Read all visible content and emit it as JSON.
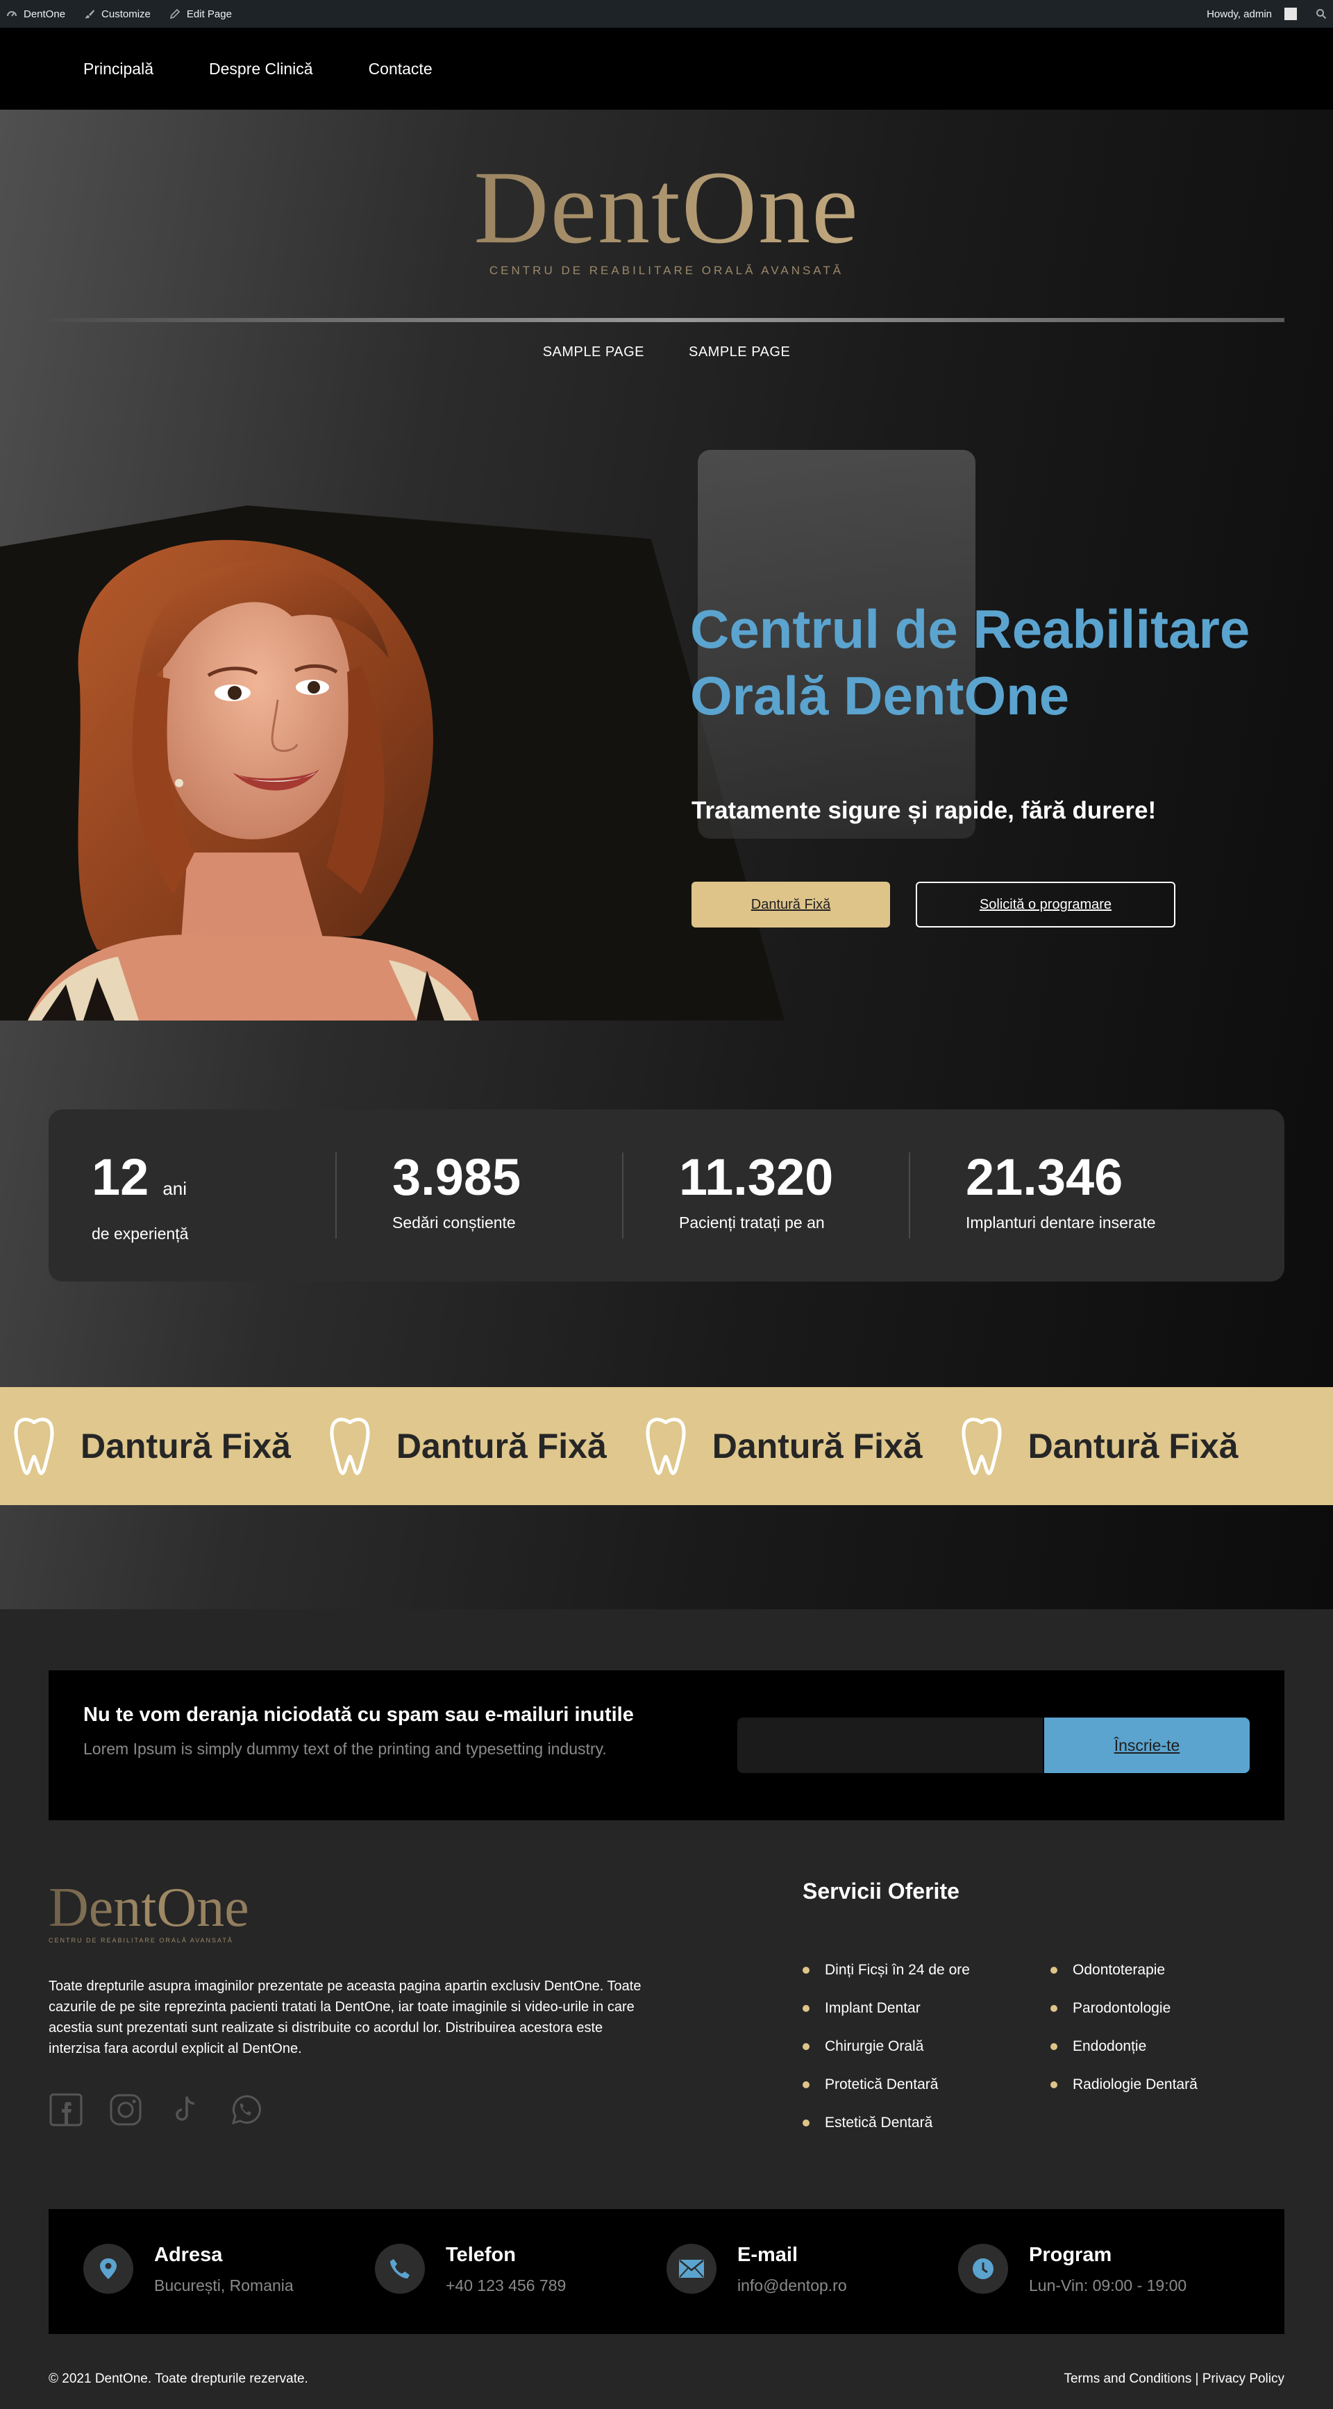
{
  "adminbar": {
    "site_name": "DentOne",
    "customize": "Customize",
    "edit_page": "Edit Page",
    "howdy": "Howdy, admin"
  },
  "topnav": {
    "items": [
      "Principală",
      "Despre Clinică",
      "Contacte"
    ]
  },
  "hero": {
    "logo": "DentOne",
    "logo_tagline": "CENTRU DE REABILITARE ORALĂ AVANSATĂ",
    "subnav": [
      "SAMPLE PAGE",
      "SAMPLE PAGE"
    ],
    "title": "Centrul de Reabilitare Orală DentOne",
    "subtitle": "Tratamente sigure și rapide, fără durere!",
    "btn_primary": "Dantură Fixă",
    "btn_secondary": "Solicită o programare",
    "title_color": "#5ba4cf",
    "accent_color": "#dfc48a"
  },
  "stats": [
    {
      "value": "12",
      "unit": "ani",
      "label": "de experiență"
    },
    {
      "value": "3.985",
      "unit": "",
      "label": "Sedări conștiente"
    },
    {
      "value": "11.320",
      "unit": "",
      "label": "Pacienți tratați pe an"
    },
    {
      "value": "21.346",
      "unit": "",
      "label": "Implanturi dentare inserate"
    }
  ],
  "marquee": {
    "text": "Dantură Fixă",
    "icon": "tooth-icon"
  },
  "newsletter": {
    "title": "Nu te vom deranja niciodată cu spam sau e-mailuri inutile",
    "text": "Lorem Ipsum is simply dummy text of the printing and typesetting industry.",
    "input_placeholder": "",
    "button": "Înscrie-te"
  },
  "footer": {
    "logo": "DentOne",
    "logo_tagline": "CENTRU DE REABILITARE ORALĂ AVANSATĂ",
    "text": "Toate drepturile asupra imaginilor prezentate pe aceasta pagina apartin exclusiv DentOne. Toate cazurile de pe site reprezinta pacienti tratati la DentOne, iar toate imaginile si video-urile in care acestia sunt prezentati sunt realizate si distribuite co acordul lor. Distribuirea acestora este interzisa fara acordul explicit al DentOne.",
    "socials": [
      "facebook-icon",
      "instagram-icon",
      "tiktok-icon",
      "whatsapp-icon"
    ],
    "services_title": "Servicii Oferite",
    "services_col1": [
      "Dinți Ficși în 24 de ore",
      "Implant Dentar",
      "Chirurgie Orală",
      "Protetică Dentară",
      "Estetică Dentară"
    ],
    "services_col2": [
      "Odontoterapie",
      "Parodontologie",
      "Endodonție",
      "Radiologie Dentară"
    ]
  },
  "contacts": [
    {
      "icon": "map-pin-icon",
      "title": "Adresa",
      "value": "București, Romania"
    },
    {
      "icon": "phone-icon",
      "title": "Telefon",
      "value": "+40 123 456 789"
    },
    {
      "icon": "mail-icon",
      "title": "E-mail",
      "value": "info@dentop.ro"
    },
    {
      "icon": "clock-icon",
      "title": "Program",
      "value": "Lun-Vin: 09:00 - 19:00"
    }
  ],
  "bottom": {
    "copyright": "© 2021 DentOne. Toate drepturile rezervate.",
    "terms": "Terms and Conditions",
    "separator": "|",
    "privacy": "Privacy Policy"
  }
}
